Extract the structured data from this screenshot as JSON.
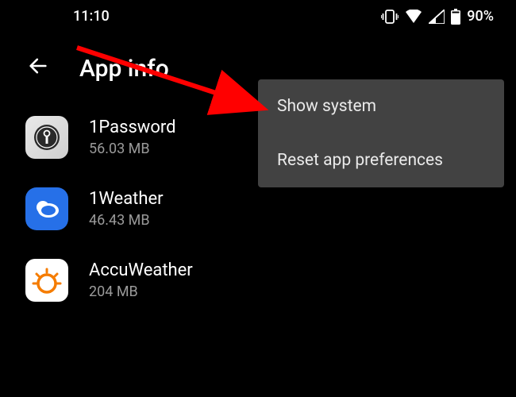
{
  "status_bar": {
    "time": "11:10",
    "battery_percent": "90%"
  },
  "header": {
    "title": "App info"
  },
  "apps": [
    {
      "name": "1Password",
      "size": "56.03 MB"
    },
    {
      "name": "1Weather",
      "size": "46.43 MB"
    },
    {
      "name": "AccuWeather",
      "size": "204 MB"
    }
  ],
  "menu": {
    "items": [
      {
        "label": "Show system"
      },
      {
        "label": "Reset app preferences"
      }
    ]
  },
  "annotation": {
    "color": "#ff0000"
  }
}
